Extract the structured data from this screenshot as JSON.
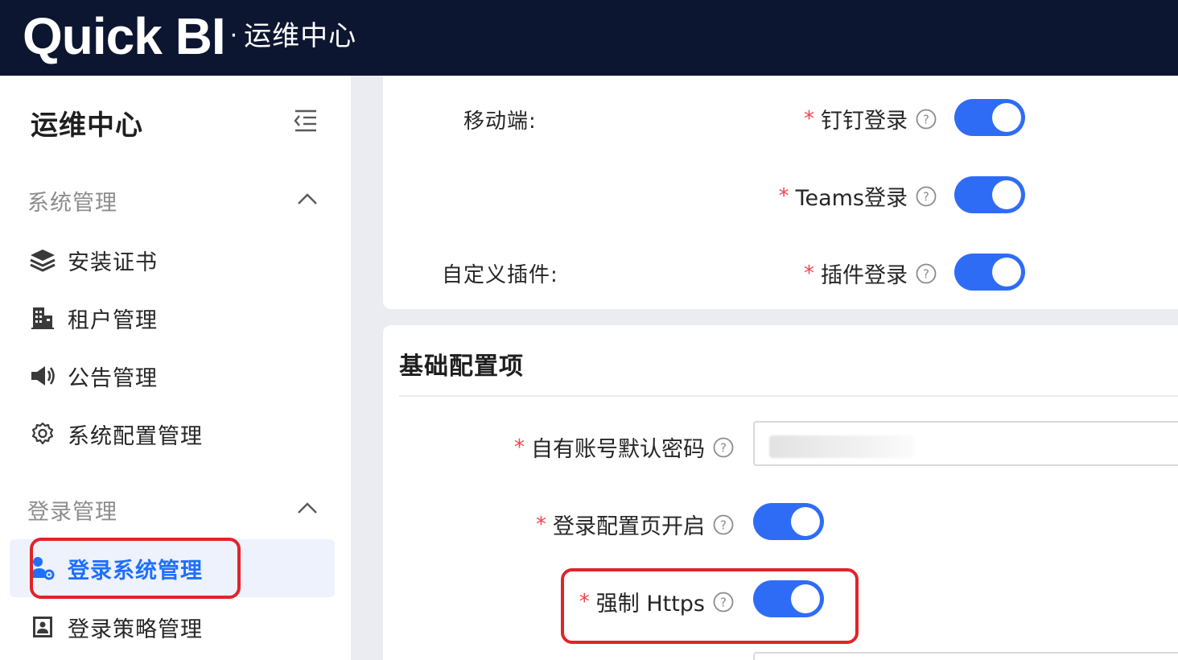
{
  "header": {
    "brand": "Quick BI",
    "separator": "·",
    "subtitle": "运维中心"
  },
  "sidebar": {
    "title": "运维中心",
    "groups": [
      {
        "label": "系统管理",
        "items": [
          {
            "label": "安装证书",
            "icon": "layers-icon"
          },
          {
            "label": "租户管理",
            "icon": "building-icon"
          },
          {
            "label": "公告管理",
            "icon": "speaker-icon"
          },
          {
            "label": "系统配置管理",
            "icon": "gear-icon"
          }
        ]
      },
      {
        "label": "登录管理",
        "items": [
          {
            "label": "登录系统管理",
            "icon": "user-gear-icon",
            "active": true
          },
          {
            "label": "登录策略管理",
            "icon": "contact-card-icon"
          }
        ]
      }
    ]
  },
  "login_card": {
    "mobile_label": "移动端:",
    "custom_plugin_label": "自定义插件:",
    "fields": [
      {
        "label": "钉钉登录",
        "required": "*",
        "enabled": true
      },
      {
        "label": "Teams登录",
        "required": "*",
        "enabled": true
      },
      {
        "label": "插件登录",
        "required": "*",
        "enabled": true
      }
    ]
  },
  "base_card": {
    "title": "基础配置项",
    "fields": [
      {
        "label": "自有账号默认密码",
        "required": "*",
        "value": ""
      },
      {
        "label": "登录配置页开启",
        "required": "*",
        "enabled": true
      },
      {
        "label": "强制 Https",
        "required": "*",
        "enabled": true
      }
    ]
  },
  "colors": {
    "topbar": "#0d1631",
    "accent": "#2f6cf6",
    "active_text": "#1f6fff",
    "required": "#f5434b",
    "highlight": "#e0242b"
  }
}
